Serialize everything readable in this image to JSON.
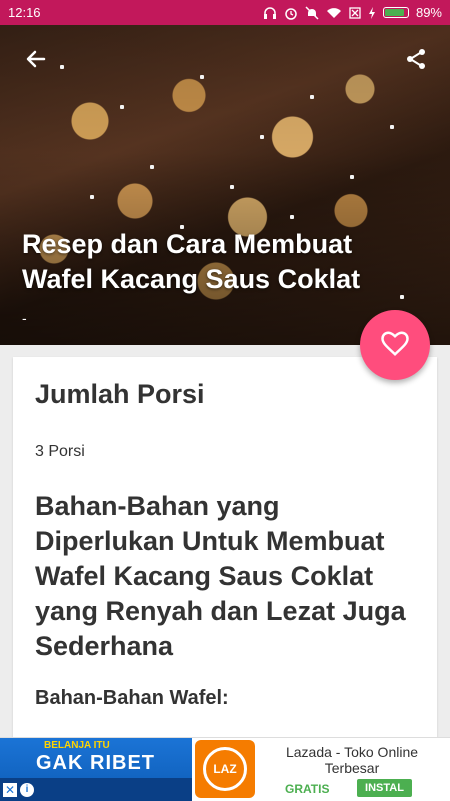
{
  "status_bar": {
    "time": "12:16",
    "battery": "89%"
  },
  "hero": {
    "title": "Resep dan Cara Membuat Wafel Kacang Saus Coklat",
    "subtitle": "-",
    "back_icon": "arrow-left-icon",
    "share_icon": "share-icon"
  },
  "fab": {
    "icon": "heart-icon"
  },
  "content": {
    "servings_heading": "Jumlah Porsi",
    "servings_value": "3 Porsi",
    "ingredients_heading": "Bahan-Bahan yang Diperlukan Untuk Membuat Wafel Kacang Saus Coklat yang Renyah dan Lezat Juga Sederhana",
    "waffle_ingredients_heading": "Bahan-Bahan Wafel:"
  },
  "ad": {
    "banner_small": "BELANJA ITU",
    "banner_big": "GAK RIBET",
    "logo_text": "LAZ",
    "app_name": "Lazada - Toko Online Terbesar",
    "price": "GRATIS",
    "install_label": "INSTAL"
  },
  "colors": {
    "status_bar": "#c2185b",
    "fab": "#ff4d7d",
    "install": "#4caf50"
  }
}
